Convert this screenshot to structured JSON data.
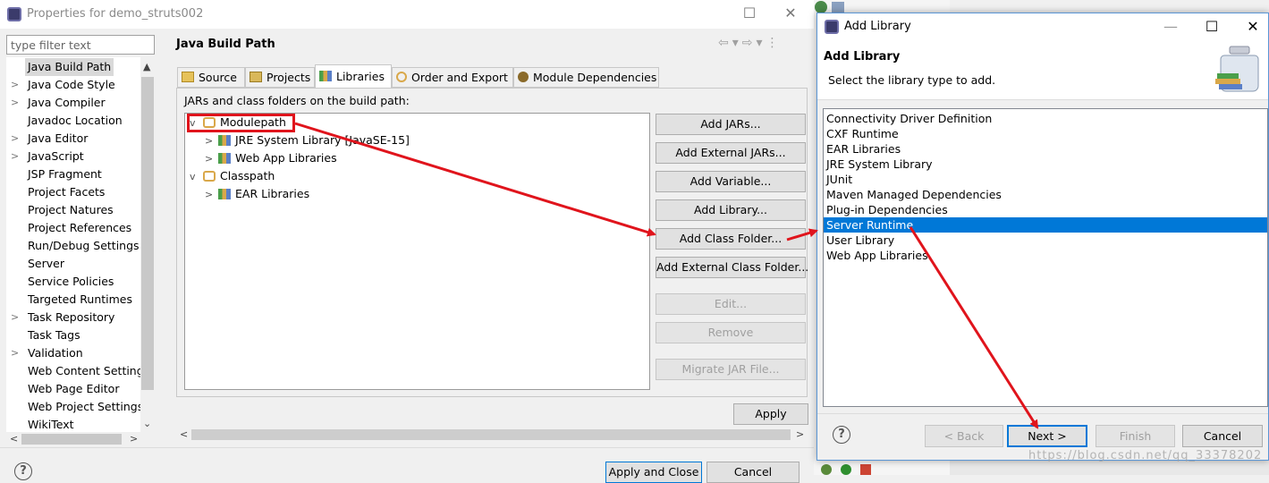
{
  "properties_window": {
    "title": "Properties for demo_struts002",
    "filter_placeholder": "type filter text",
    "nav_items": [
      {
        "label": "Java Build Path",
        "expandable": false,
        "selected": true
      },
      {
        "label": "Java Code Style",
        "expandable": true
      },
      {
        "label": "Java Compiler",
        "expandable": true
      },
      {
        "label": "Javadoc Location",
        "expandable": false
      },
      {
        "label": "Java Editor",
        "expandable": true
      },
      {
        "label": "JavaScript",
        "expandable": true
      },
      {
        "label": "JSP Fragment",
        "expandable": false
      },
      {
        "label": "Project Facets",
        "expandable": false
      },
      {
        "label": "Project Natures",
        "expandable": false
      },
      {
        "label": "Project References",
        "expandable": false
      },
      {
        "label": "Run/Debug Settings",
        "expandable": false
      },
      {
        "label": "Server",
        "expandable": false
      },
      {
        "label": "Service Policies",
        "expandable": false
      },
      {
        "label": "Targeted Runtimes",
        "expandable": false
      },
      {
        "label": "Task Repository",
        "expandable": true
      },
      {
        "label": "Task Tags",
        "expandable": false
      },
      {
        "label": "Validation",
        "expandable": true
      },
      {
        "label": "Web Content Settings",
        "expandable": false
      },
      {
        "label": "Web Page Editor",
        "expandable": false
      },
      {
        "label": "Web Project Settings",
        "expandable": false
      },
      {
        "label": "WikiText",
        "expandable": false
      }
    ],
    "page_title": "Java Build Path",
    "tabs": [
      "Source",
      "Projects",
      "Libraries",
      "Order and Export",
      "Module Dependencies"
    ],
    "active_tab": "Libraries",
    "path_label": "JARs and class folders on the build path:",
    "tree": {
      "modulepath": "Modulepath",
      "modulepath_children": [
        "JRE System Library [JavaSE-15]",
        "Web App Libraries"
      ],
      "classpath": "Classpath",
      "classpath_children": [
        "EAR Libraries"
      ]
    },
    "buttons": {
      "add_jars": "Add JARs...",
      "add_external_jars": "Add External JARs...",
      "add_variable": "Add Variable...",
      "add_library": "Add Library...",
      "add_class_folder": "Add Class Folder...",
      "add_external_class_folder": "Add External Class Folder...",
      "edit": "Edit...",
      "remove": "Remove",
      "migrate_jar": "Migrate JAR File...",
      "apply": "Apply",
      "apply_close": "Apply and Close",
      "cancel": "Cancel"
    }
  },
  "add_library_dialog": {
    "title": "Add Library",
    "header_title": "Add Library",
    "header_desc": "Select the library type to add.",
    "library_types": [
      "Connectivity Driver Definition",
      "CXF Runtime",
      "EAR Libraries",
      "JRE System Library",
      "JUnit",
      "Maven Managed Dependencies",
      "Plug-in Dependencies",
      "Server Runtime",
      "User Library",
      "Web App Libraries"
    ],
    "selected_type": "Server Runtime",
    "buttons": {
      "back": "< Back",
      "next": "Next >",
      "finish": "Finish",
      "cancel": "Cancel"
    }
  },
  "watermark": "https://blog.csdn.net/qq_33378202",
  "colors": {
    "selection": "#0078d7",
    "annotation_red": "#e0141c"
  }
}
